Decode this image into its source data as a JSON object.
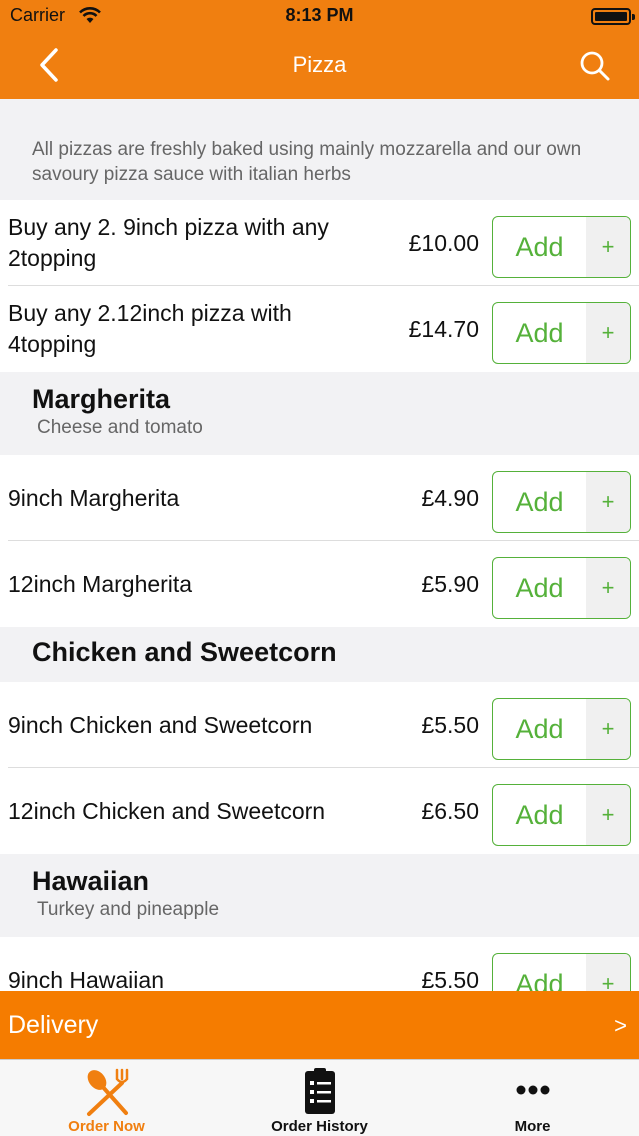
{
  "status": {
    "carrier": "Carrier",
    "time": "8:13 PM"
  },
  "nav": {
    "title": "Pizza"
  },
  "intro": "All pizzas are freshly baked using mainly mozzarella and our own savoury pizza sauce with italian herbs",
  "add_label": "Add",
  "plus_label": "+",
  "deals": [
    {
      "name": "Buy any 2. 9inch pizza with any 2topping",
      "price": "£10.00"
    },
    {
      "name": "Buy any 2.12inch pizza with 4topping",
      "price": "£14.70"
    }
  ],
  "sections": [
    {
      "title": "Margherita",
      "subtitle": "Cheese and tomato",
      "items": [
        {
          "name": "9inch Margherita",
          "price": "£4.90"
        },
        {
          "name": "12inch Margherita",
          "price": "£5.90"
        }
      ]
    },
    {
      "title": "Chicken and Sweetcorn",
      "subtitle": "",
      "items": [
        {
          "name": "9inch Chicken and Sweetcorn",
          "price": "£5.50"
        },
        {
          "name": "12inch Chicken and Sweetcorn",
          "price": "£6.50"
        }
      ]
    },
    {
      "title": "Hawaiian",
      "subtitle": "Turkey and pineapple",
      "items": [
        {
          "name": "9inch Hawaiian",
          "price": "£5.50"
        }
      ]
    }
  ],
  "delivery": {
    "label": "Delivery",
    "arrow": ">"
  },
  "tabs": [
    {
      "label": "Order Now",
      "icon": "fork-knife-icon",
      "active": true
    },
    {
      "label": "Order History",
      "icon": "clipboard-list-icon",
      "active": false
    },
    {
      "label": "More",
      "icon": "more-dots-icon",
      "active": false
    }
  ],
  "colors": {
    "brand": "#f07f10",
    "accent_green": "#55b13a",
    "delivery": "#f57c00"
  }
}
